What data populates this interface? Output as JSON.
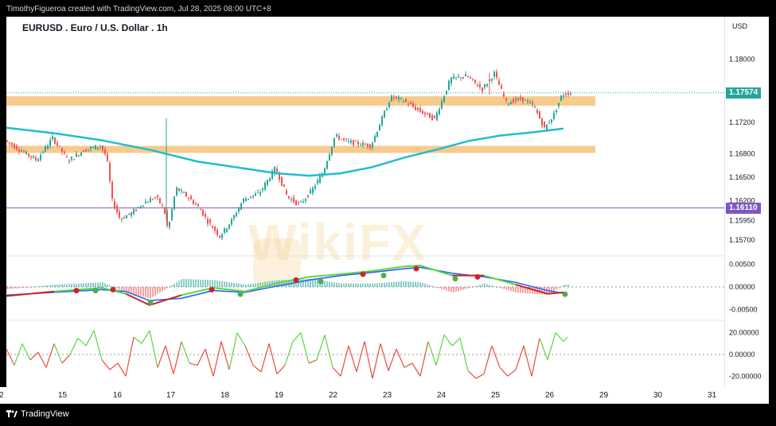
{
  "header": {
    "byline": "TimothyFigueroa created with TradingView.com, Jul 28, 2025 08:00 UTC+8"
  },
  "chart_header": {
    "title": "EURUSD . Euro / U.S. Dollar . 1h",
    "currency": "USD"
  },
  "watermark": {
    "text": "WikiFX"
  },
  "footer": {
    "brand": "TradingView"
  },
  "colors": {
    "up": "#26a69a",
    "down": "#ef5350",
    "ma": "#22bcd0",
    "zone": "#f6c27a",
    "last_price": "#26a69a",
    "hline": "#7e57c2",
    "macd": "#2962ff",
    "signal": "#26a69a",
    "rsi_up": "#5ad63e",
    "rsi_down": "#e74c3c"
  },
  "price_badges": {
    "last": "1.17574",
    "level": "1.16110"
  },
  "chart_data": [
    {
      "type": "candlestick",
      "title": "EURUSD . Euro / U.S. Dollar . 1h",
      "x_ticks": [
        "2",
        "15",
        "16",
        "17",
        "18",
        "19",
        "22",
        "23",
        "24",
        "25",
        "26",
        "29",
        "30",
        "31"
      ],
      "y_ticks": [
        "1.18000",
        "1.17200",
        "1.16800",
        "1.16500",
        "1.16200",
        "1.15950",
        "1.15700"
      ],
      "ylim": [
        1.155,
        1.1835
      ],
      "zones": [
        {
          "low": 1.1741,
          "high": 1.1753
        },
        {
          "low": 1.1681,
          "high": 1.169
        }
      ],
      "horizontal_lines": [
        1.1611
      ],
      "last_price": 1.17574,
      "moving_average": [
        [
          0,
          1.1713
        ],
        [
          60,
          1.1706
        ],
        [
          120,
          1.1697
        ],
        [
          180,
          1.1685
        ],
        [
          240,
          1.167
        ],
        [
          300,
          1.1661
        ],
        [
          340,
          1.1655
        ],
        [
          380,
          1.1652
        ],
        [
          420,
          1.1655
        ],
        [
          460,
          1.1663
        ],
        [
          500,
          1.1675
        ],
        [
          540,
          1.1685
        ],
        [
          580,
          1.1696
        ],
        [
          620,
          1.1703
        ],
        [
          660,
          1.1707
        ],
        [
          700,
          1.1712
        ]
      ],
      "price_path": [
        [
          0,
          1.1697
        ],
        [
          20,
          1.1684
        ],
        [
          40,
          1.1672
        ],
        [
          60,
          1.17
        ],
        [
          80,
          1.1671
        ],
        [
          100,
          1.1685
        ],
        [
          120,
          1.169
        ],
        [
          128,
          1.1676
        ],
        [
          135,
          1.162
        ],
        [
          145,
          1.1597
        ],
        [
          160,
          1.1605
        ],
        [
          175,
          1.1618
        ],
        [
          190,
          1.1625
        ],
        [
          200,
          1.161
        ],
        [
          205,
          1.1582
        ],
        [
          215,
          1.1636
        ],
        [
          230,
          1.1625
        ],
        [
          245,
          1.161
        ],
        [
          255,
          1.1594
        ],
        [
          270,
          1.1575
        ],
        [
          285,
          1.1595
        ],
        [
          300,
          1.1622
        ],
        [
          320,
          1.163
        ],
        [
          340,
          1.1662
        ],
        [
          355,
          1.1625
        ],
        [
          370,
          1.1615
        ],
        [
          385,
          1.1632
        ],
        [
          400,
          1.1657
        ],
        [
          415,
          1.1703
        ],
        [
          430,
          1.1695
        ],
        [
          445,
          1.1693
        ],
        [
          460,
          1.169
        ],
        [
          472,
          1.172
        ],
        [
          485,
          1.1752
        ],
        [
          500,
          1.1748
        ],
        [
          520,
          1.1735
        ],
        [
          540,
          1.1724
        ],
        [
          560,
          1.1775
        ],
        [
          580,
          1.1779
        ],
        [
          600,
          1.1762
        ],
        [
          615,
          1.1782
        ],
        [
          630,
          1.1745
        ],
        [
          650,
          1.175
        ],
        [
          665,
          1.174
        ],
        [
          678,
          1.1712
        ],
        [
          690,
          1.173
        ],
        [
          700,
          1.1755
        ],
        [
          708,
          1.1757
        ]
      ]
    },
    {
      "type": "line",
      "title": "",
      "y_ticks": [
        "0.00500",
        "0.00000",
        "-0.00500"
      ],
      "ylim": [
        -0.0068,
        0.0068
      ],
      "series": [
        {
          "values": [
            [
              0,
              -0.002
            ],
            [
              60,
              -0.001
            ],
            [
              120,
              -0.0002
            ],
            [
              150,
              -0.0015
            ],
            [
              180,
              -0.004
            ],
            [
              220,
              -0.0018
            ],
            [
              260,
              -0.0002
            ],
            [
              300,
              -0.001
            ],
            [
              340,
              0.0008
            ],
            [
              380,
              0.0022
            ],
            [
              420,
              0.0028
            ],
            [
              460,
              0.0035
            ],
            [
              500,
              0.0045
            ],
            [
              520,
              0.0047
            ],
            [
              560,
              0.0025
            ],
            [
              600,
              0.0025
            ],
            [
              640,
              0.0005
            ],
            [
              680,
              -0.0015
            ],
            [
              700,
              -0.0012
            ]
          ]
        },
        {
          "values": [
            [
              0,
              -0.0018
            ],
            [
              60,
              -0.0012
            ],
            [
              120,
              -0.0006
            ],
            [
              150,
              -0.001
            ],
            [
              180,
              -0.003
            ],
            [
              220,
              -0.0025
            ],
            [
              260,
              -0.0008
            ],
            [
              300,
              -0.0012
            ],
            [
              340,
              0.0002
            ],
            [
              380,
              0.0015
            ],
            [
              420,
              0.0025
            ],
            [
              460,
              0.0032
            ],
            [
              500,
              0.004
            ],
            [
              520,
              0.0043
            ],
            [
              560,
              0.003
            ],
            [
              600,
              0.0022
            ],
            [
              640,
              0.001
            ],
            [
              680,
              -0.0008
            ],
            [
              700,
              -0.0014
            ]
          ]
        }
      ],
      "crossings": [
        {
          "x": 88,
          "v": -0.0008,
          "up": false
        },
        {
          "x": 112,
          "v": -0.0008,
          "up": true
        },
        {
          "x": 134,
          "v": -0.0006,
          "up": false
        },
        {
          "x": 181,
          "v": -0.0034,
          "up": true
        },
        {
          "x": 258,
          "v": -0.0006,
          "up": false
        },
        {
          "x": 294,
          "v": -0.0016,
          "up": true
        },
        {
          "x": 364,
          "v": 0.0015,
          "up": false
        },
        {
          "x": 395,
          "v": 0.0012,
          "up": true
        },
        {
          "x": 448,
          "v": 0.0028,
          "up": false
        },
        {
          "x": 474,
          "v": 0.0025,
          "up": true
        },
        {
          "x": 515,
          "v": 0.004,
          "up": false
        },
        {
          "x": 564,
          "v": 0.0018,
          "up": true
        },
        {
          "x": 592,
          "v": 0.0022,
          "up": false
        },
        {
          "x": 702,
          "v": -0.0016,
          "up": true
        }
      ]
    },
    {
      "type": "line",
      "title": "",
      "y_ticks": [
        "20.00000",
        "0.00000",
        "-20.00000"
      ],
      "ylim": [
        -30,
        30
      ],
      "series": [
        {
          "values": [
            [
              0,
              5
            ],
            [
              10,
              -10
            ],
            [
              20,
              10
            ],
            [
              30,
              -5
            ],
            [
              40,
              2
            ],
            [
              50,
              -12
            ],
            [
              60,
              10
            ],
            [
              70,
              -8
            ],
            [
              80,
              0
            ],
            [
              90,
              15
            ],
            [
              100,
              8
            ],
            [
              110,
              22
            ],
            [
              120,
              -5
            ],
            [
              130,
              -14
            ],
            [
              140,
              -8
            ],
            [
              150,
              -20
            ],
            [
              160,
              16
            ],
            [
              170,
              10
            ],
            [
              180,
              22
            ],
            [
              190,
              -12
            ],
            [
              200,
              8
            ],
            [
              210,
              -18
            ],
            [
              220,
              12
            ],
            [
              230,
              -8
            ],
            [
              240,
              -10
            ],
            [
              250,
              5
            ],
            [
              260,
              -20
            ],
            [
              270,
              12
            ],
            [
              280,
              -14
            ],
            [
              290,
              20
            ],
            [
              300,
              8
            ],
            [
              310,
              -10
            ],
            [
              320,
              -16
            ],
            [
              330,
              10
            ],
            [
              340,
              -18
            ],
            [
              350,
              -10
            ],
            [
              360,
              12
            ],
            [
              370,
              20
            ],
            [
              380,
              -8
            ],
            [
              390,
              -5
            ],
            [
              400,
              18
            ],
            [
              410,
              -12
            ],
            [
              420,
              -20
            ],
            [
              430,
              8
            ],
            [
              440,
              -16
            ],
            [
              450,
              12
            ],
            [
              460,
              -22
            ],
            [
              470,
              10
            ],
            [
              480,
              -15
            ],
            [
              490,
              5
            ],
            [
              500,
              -12
            ],
            [
              510,
              -8
            ],
            [
              520,
              -20
            ],
            [
              530,
              12
            ],
            [
              540,
              -10
            ],
            [
              550,
              18
            ],
            [
              560,
              8
            ],
            [
              570,
              15
            ],
            [
              580,
              -15
            ],
            [
              590,
              -22
            ],
            [
              600,
              -18
            ],
            [
              610,
              8
            ],
            [
              620,
              -12
            ],
            [
              630,
              -20
            ],
            [
              640,
              -14
            ],
            [
              650,
              8
            ],
            [
              660,
              -20
            ],
            [
              670,
              15
            ],
            [
              680,
              -5
            ],
            [
              690,
              20
            ],
            [
              700,
              12
            ],
            [
              705,
              16
            ]
          ]
        }
      ]
    }
  ]
}
